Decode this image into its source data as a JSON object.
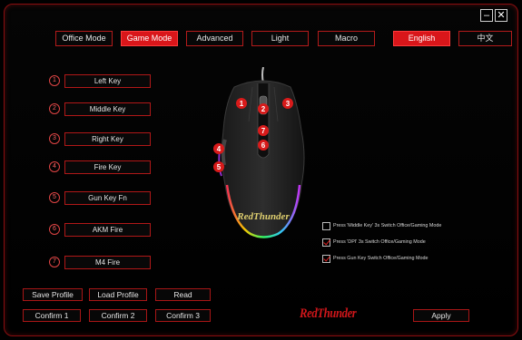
{
  "window": {
    "minimize_glyph": "–",
    "close_glyph": "✕"
  },
  "tabs": [
    {
      "label": "Office Mode",
      "active": false
    },
    {
      "label": "Game Mode",
      "active": true
    },
    {
      "label": "Advanced",
      "active": false
    },
    {
      "label": "Light",
      "active": false
    },
    {
      "label": "Macro",
      "active": false
    },
    {
      "label": "English",
      "active": true
    },
    {
      "label": "中文",
      "active": false
    }
  ],
  "keys": [
    {
      "num": "1",
      "label": "Left Key"
    },
    {
      "num": "2",
      "label": "Middle Key"
    },
    {
      "num": "3",
      "label": "Right Key"
    },
    {
      "num": "4",
      "label": "Fire Key"
    },
    {
      "num": "5",
      "label": "Gun Key Fn"
    },
    {
      "num": "6",
      "label": "AKM Fire"
    },
    {
      "num": "7",
      "label": "M4 Fire"
    }
  ],
  "mouse": {
    "brand_logo": "RedThunder",
    "markers": [
      "1",
      "2",
      "3",
      "4",
      "5",
      "6",
      "7"
    ]
  },
  "options": [
    {
      "label": "Press 'Middle Key' 3s Switch Office/Gaming Mode",
      "checked": false
    },
    {
      "label": "Press 'DPI' 3s Switch Office/Gaming Mode",
      "checked": true
    },
    {
      "label": "Press Gun Key Switch Office/Gaming Mode",
      "checked": true
    }
  ],
  "bottom": {
    "save_profile": "Save Profile",
    "load_profile": "Load Profile",
    "read": "Read",
    "confirm1": "Confirm 1",
    "confirm2": "Confirm 2",
    "confirm3": "Confirm 3",
    "apply": "Apply",
    "brand": "RedThunder"
  },
  "colors": {
    "accent": "#d9161a",
    "border": "#b51b1b",
    "background": "#000000"
  }
}
